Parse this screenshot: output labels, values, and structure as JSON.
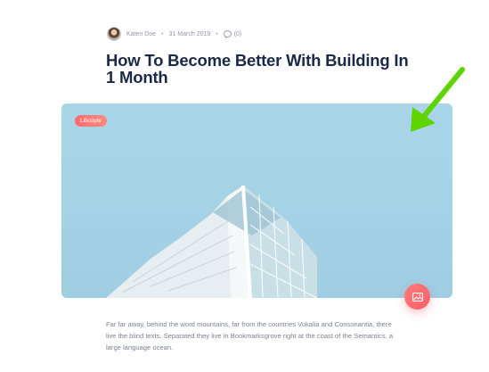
{
  "meta": {
    "author": "Katen Doe",
    "separator": "•",
    "date": "31 March 2019",
    "comments": "(0)"
  },
  "post": {
    "title": "How To Become Better With Building In 1 Month",
    "category": "Lifestyle",
    "excerpt": "Far far away, behind the word mountains, far from the countries Vokalia and Consonantia, there live the blind texts. Separated they live in Bookmarksgrove right at the coast of the Semantics, a large language ocean."
  },
  "icons": {
    "comment": "comment-icon",
    "image_format": "image-icon",
    "annotation": "arrow-icon"
  },
  "colors": {
    "title": "#1b2947",
    "accent": "#ff6b73",
    "annotation_arrow": "#5ed400",
    "sky": "#a9d5e8"
  }
}
